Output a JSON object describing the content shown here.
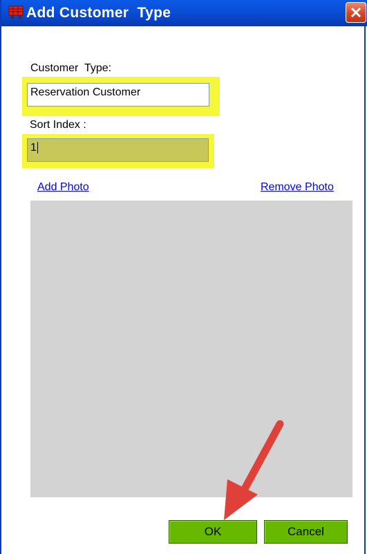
{
  "window": {
    "title": "Add Customer  Type",
    "close_icon": "close-icon",
    "app_icon": "shopping-cart-icon"
  },
  "form": {
    "customer_type_label": "Customer  Type:",
    "customer_type_value": "Reservation Customer",
    "sort_index_label": "Sort Index :",
    "sort_index_value": "1"
  },
  "photo": {
    "add_label": "Add Photo",
    "remove_label": "Remove Photo"
  },
  "buttons": {
    "ok_label": "OK",
    "cancel_label": "Cancel"
  },
  "colors": {
    "titlebar": "#0a4fd8",
    "highlight": "#f7f73a",
    "button": "#67b900",
    "annotation_arrow": "#e0403a"
  }
}
